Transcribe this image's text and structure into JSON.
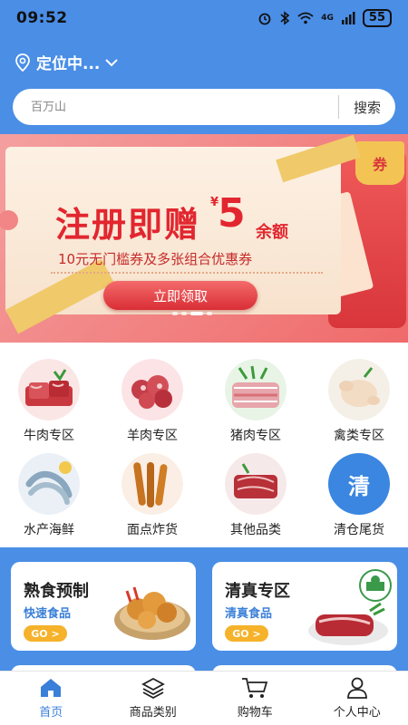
{
  "status_bar": {
    "time": "09:52",
    "network": "4G",
    "battery": "55"
  },
  "header": {
    "location": "定位中...",
    "search_placeholder": "百万山",
    "search_button": "搜索"
  },
  "banner": {
    "title": "注册即赠",
    "currency": "¥",
    "amount": "5",
    "amount_suffix": "余额",
    "subtitle": "10元无门槛券及多张组合优惠券",
    "cta": "立即领取",
    "coupon_tag": "券",
    "coupon_paper": "优惠"
  },
  "categories": [
    {
      "label": "牛肉专区",
      "icon": "beef-image"
    },
    {
      "label": "羊肉专区",
      "icon": "lamb-image"
    },
    {
      "label": "猪肉专区",
      "icon": "pork-image"
    },
    {
      "label": "禽类专区",
      "icon": "poultry-image"
    },
    {
      "label": "水产海鲜",
      "icon": "seafood-image"
    },
    {
      "label": "面点炸货",
      "icon": "fried-food-image"
    },
    {
      "label": "其他品类",
      "icon": "other-image"
    },
    {
      "label": "清仓尾货",
      "icon": "clearance-icon",
      "badge": "清"
    }
  ],
  "promos": [
    {
      "title": "熟食预制",
      "subtitle": "快速食品",
      "go": "GO >"
    },
    {
      "title": "清真专区",
      "subtitle": "清真食品",
      "go": "GO >"
    }
  ],
  "tabbar": [
    {
      "label": "首页",
      "icon": "home-icon",
      "active": true
    },
    {
      "label": "商品类别",
      "icon": "layers-icon",
      "active": false
    },
    {
      "label": "购物车",
      "icon": "cart-icon",
      "active": false
    },
    {
      "label": "个人中心",
      "icon": "user-icon",
      "active": false
    }
  ],
  "colors": {
    "primary": "#4a8ee6",
    "accent": "#3a7fd8",
    "banner_red": "#e2262f",
    "go_orange": "#f5b22a"
  }
}
